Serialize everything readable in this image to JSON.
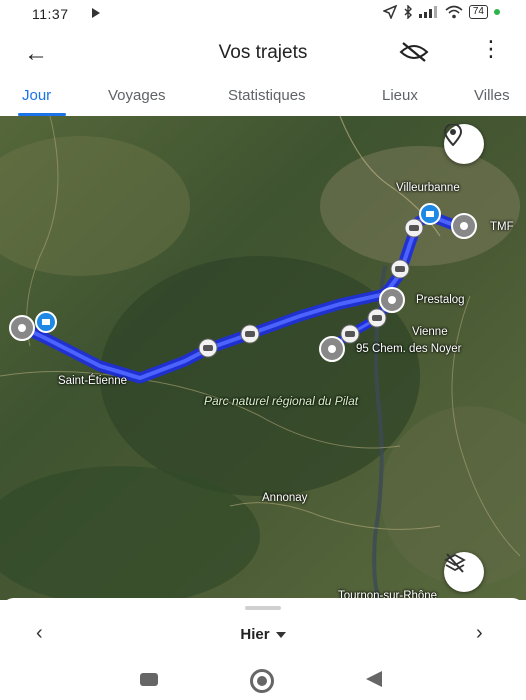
{
  "status_bar": {
    "time": "11:37",
    "battery": "74"
  },
  "app_bar": {
    "title": "Vos trajets"
  },
  "tabs": [
    {
      "label": "Jour",
      "active": true
    },
    {
      "label": "Voyages",
      "active": false
    },
    {
      "label": "Statistiques",
      "active": false
    },
    {
      "label": "Lieux",
      "active": false
    },
    {
      "label": "Villes",
      "active": false
    }
  ],
  "map": {
    "labels": {
      "villeurbanne": "Villeurbanne",
      "tmf": "TMF",
      "prestalog": "Prestalog",
      "vienne": "Vienne",
      "address": "95 Chem. des Noyer",
      "saint_etienne": "Saint-Étienne",
      "park": "Parc naturel régional du Pilat",
      "annonay": "Annonay",
      "tournon": "Tournon-sur-Rhône"
    },
    "route_color": "#2a3cf0"
  },
  "bottom_sheet": {
    "day_label": "Hier"
  }
}
